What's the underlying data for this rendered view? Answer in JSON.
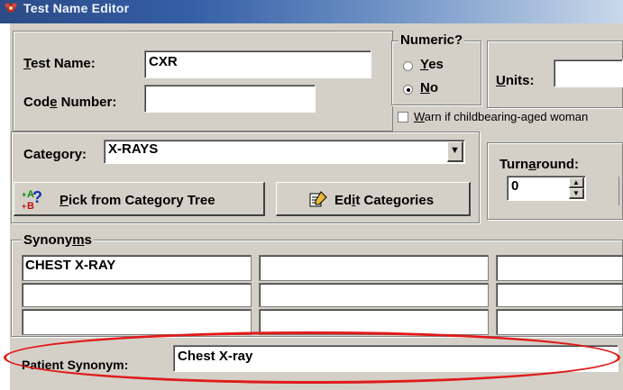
{
  "window": {
    "title": "Test Name Editor",
    "icon": "app-icon"
  },
  "test_name": {
    "label_prefix": "",
    "label_mnemonic": "T",
    "label_rest": "est Name:",
    "value": "CXR"
  },
  "code_number": {
    "label_pre": "Cod",
    "label_mnemonic": "e",
    "label_post": " Number:",
    "value": ""
  },
  "numeric": {
    "title": "Numeric?",
    "yes_mnemonic": "Y",
    "yes_rest": "es",
    "no_mnemonic": "N",
    "no_rest": "o",
    "selected": "No"
  },
  "units": {
    "label_mnemonic": "U",
    "label_rest": "nits:",
    "value": ""
  },
  "warn": {
    "label_mnemonic": "W",
    "label_rest": "arn if childbearing-aged woman",
    "checked": false
  },
  "category": {
    "label_pre": "Cate",
    "label_mnemonic": "g",
    "label_post": "ory:",
    "value": "X-RAYS"
  },
  "turnaround": {
    "label_pre": "Turn",
    "label_mnemonic": "a",
    "label_post": "round:",
    "value": "0"
  },
  "buttons": {
    "pick_icon_text": "?",
    "pick_mnemonic": "P",
    "pick_rest": "ick from Category Tree",
    "edit_pre": "Ed",
    "edit_mnemonic": "i",
    "edit_post": "t Categories"
  },
  "synonyms": {
    "title_pre": "Synony",
    "title_mnemonic": "m",
    "title_post": "s",
    "cells": [
      "CHEST X-RAY",
      "",
      "",
      "",
      "",
      "",
      "",
      "",
      ""
    ]
  },
  "patient_synonym": {
    "label": "Patient Synonym:",
    "value": "Chest X-ray"
  },
  "colors": {
    "highlight": "#e01b1b",
    "dialog_bg": "#d4d0c8",
    "titlebar": "#345ea5"
  }
}
